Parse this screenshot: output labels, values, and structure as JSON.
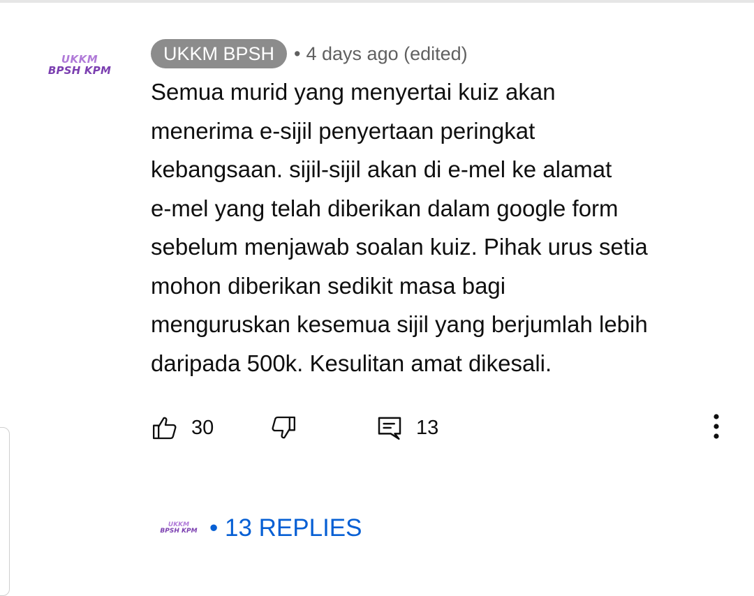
{
  "comment": {
    "avatar_line1": "UKKM",
    "avatar_line2": "BPSH KPM",
    "author": "UKKM BPSH",
    "separator": "•",
    "timestamp": "4 days ago (edited)",
    "body": "Semua murid yang menyertai kuiz akan\nmenerima e-sijil penyertaan peringkat\nkebangsaan. sijil-sijil akan di e-mel ke alamat\ne-mel yang telah diberikan dalam google form\nsebelum menjawab soalan kuiz. Pihak urus setia\nmohon diberikan sedikit masa bagi\nmenguruskan kesemua sijil yang berjumlah lebih\ndaripada 500k. Kesulitan amat dikesali."
  },
  "actions": {
    "like_icon": "thumb-up-icon",
    "like_count": "30",
    "dislike_icon": "thumb-down-icon",
    "reply_icon": "comment-reply-icon",
    "reply_count": "13",
    "more_icon": "more-vertical-icon"
  },
  "replies": {
    "avatar_line1": "UKKM",
    "avatar_line2": "BPSH KPM",
    "label": "• 13 REPLIES"
  },
  "colors": {
    "author_chip_bg": "#8c8c8c",
    "meta_text": "#606060",
    "link_blue": "#065fd4",
    "avatar_light_purple": "#b07ad8",
    "avatar_dark_purple": "#7b3fb0"
  }
}
